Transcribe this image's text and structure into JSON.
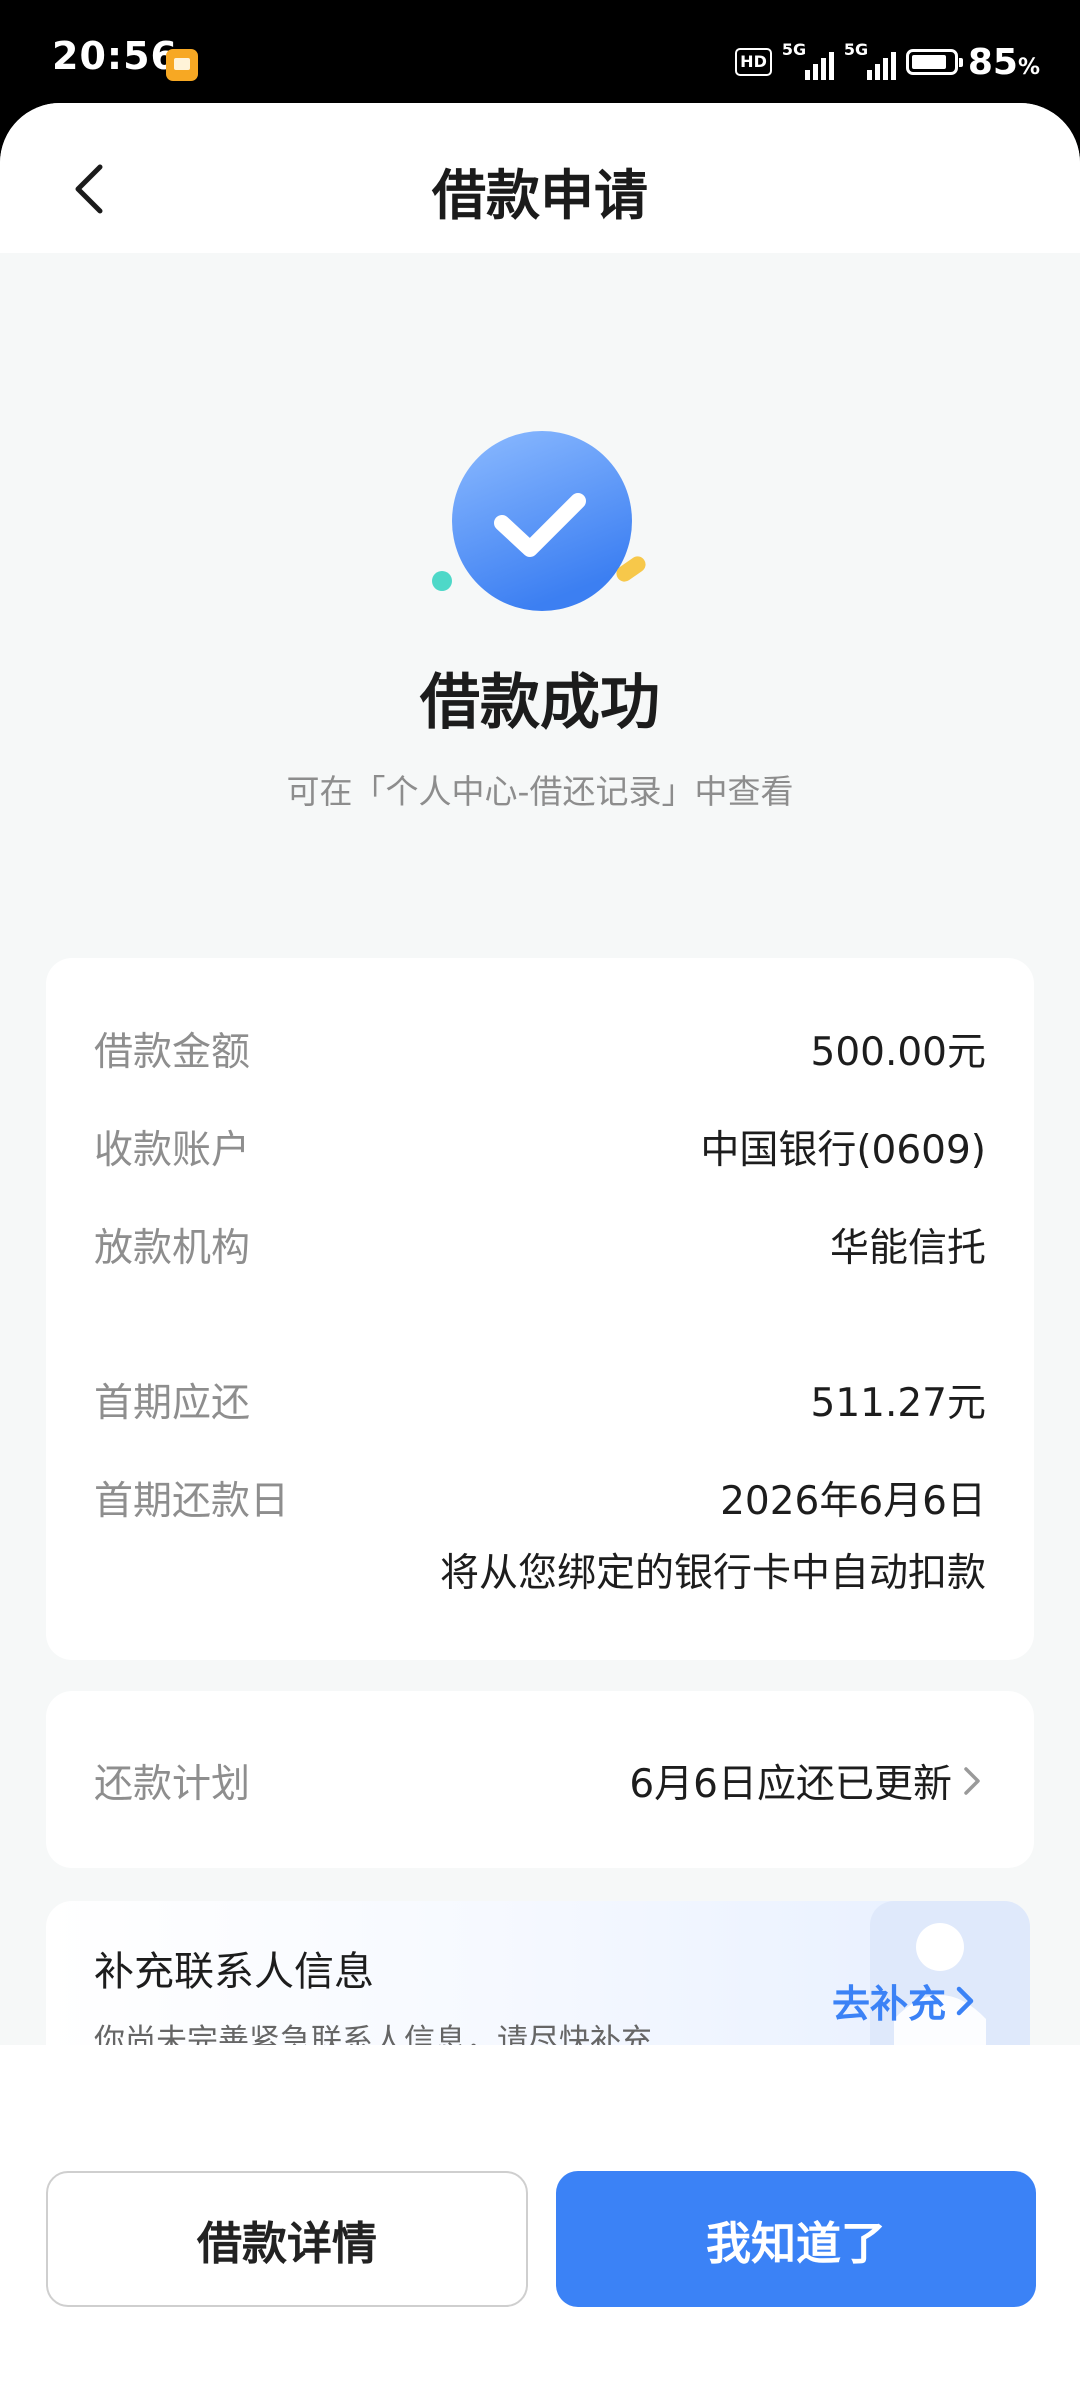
{
  "status_bar": {
    "time": "20:56",
    "hd_badge": "HD",
    "network_1": "5G",
    "network_2": "5G",
    "battery_percent": "85",
    "battery_unit": "%",
    "battery_level": 0.85
  },
  "header": {
    "title": "借款申请"
  },
  "result": {
    "title": "借款成功",
    "subtitle": "可在「个人中心-借还记录」中查看",
    "icon_color": "#4a8ff6"
  },
  "details": {
    "rows": [
      {
        "label": "借款金额",
        "value": "500.00元"
      },
      {
        "label": "收款账户",
        "value": "中国银行(0609)"
      },
      {
        "label": "放款机构",
        "value": "华能信托"
      },
      {
        "label": "首期应还",
        "value": "511.27元"
      },
      {
        "label": "首期还款日",
        "value": "2026年6月6日"
      }
    ],
    "note": "将从您绑定的银行卡中自动扣款"
  },
  "plan": {
    "label": "还款计划",
    "value": "6月6日应还已更新"
  },
  "contact": {
    "title": "补充联系人信息",
    "description": "你尚未完善紧急联系人信息，请尽快补充",
    "link": "去补充"
  },
  "actions": {
    "secondary": "借款详情",
    "primary": "我知道了"
  },
  "colors": {
    "accent": "#3b82f6",
    "page_bg": "#f6f8f8"
  }
}
